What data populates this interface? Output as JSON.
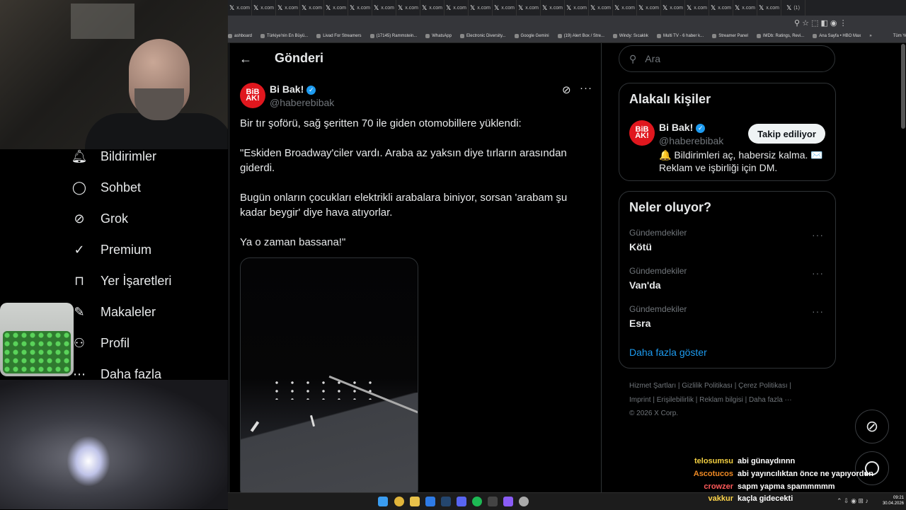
{
  "browser": {
    "tabs": [
      "x.com",
      "x.com",
      "x.com",
      "x.com",
      "x.com",
      "x.com",
      "x.com",
      "x.com",
      "x.com",
      "x.com",
      "x.com",
      "x.com",
      "x.com",
      "x.com",
      "x.com",
      "x.com",
      "x.com",
      "x.com",
      "x.com",
      "x.com",
      "x.com",
      "x.com",
      "x.com",
      "(1)"
    ],
    "bookmarks": [
      "ashboard",
      "Türkiye'nin En Büyü...",
      "Livad For Streamers",
      "(17145) Rammstein...",
      "WhatsApp",
      "Electronic Diversity...",
      "Google Gemini",
      "(19) Alert Box / Stre...",
      "Windy: Sıcaklık",
      "Multi TV - 6 haber k...",
      "Streamer Panel",
      "IMDb: Ratings, Revi...",
      "Ana Sayfa • HBO Max"
    ],
    "bookmarks_more": "»",
    "all_bookmarks": "Tüm Yer İşaretleri"
  },
  "sidebar": {
    "items": [
      {
        "label": "Bildirimler",
        "icon": "bell-icon"
      },
      {
        "label": "Sohbet",
        "icon": "chat-icon"
      },
      {
        "label": "Grok",
        "icon": "grok-icon"
      },
      {
        "label": "Premium",
        "icon": "premium-icon"
      },
      {
        "label": "Yer İşaretleri",
        "icon": "bookmark-icon"
      },
      {
        "label": "Makaleler",
        "icon": "article-icon"
      },
      {
        "label": "Profil",
        "icon": "profile-icon"
      },
      {
        "label": "Daha fazla",
        "icon": "more-icon"
      }
    ]
  },
  "post": {
    "header_title": "Gönderi",
    "author_name": "Bi Bak!",
    "author_handle": "@haberebibak",
    "avatar_text": "BiBAK!",
    "paragraphs": [
      "Bir tır şoförü, sağ şeritten 70 ile giden otomobillere yüklendi:",
      "\"Eskiden Broadway'ciler vardı. Araba az yaksın diye tırların arasından giderdi.",
      "Bugün onların çocukları elektrikli arabalara biniyor, sorsan 'arabam şu kadar beygir' diye hava atıyorlar.",
      "Ya o zaman bassana!\""
    ]
  },
  "right": {
    "search_placeholder": "Ara",
    "related_title": "Alakalı kişiler",
    "related_name": "Bi Bak!",
    "related_handle": "@haberebibak",
    "related_bio": "🔔 Bildirimleri aç, habersiz kalma. ✉️ Reklam ve işbirliği için DM.",
    "follow_label": "Takip ediliyor",
    "trends_title": "Neler oluyor?",
    "trends": [
      {
        "label": "Gündemdekiler",
        "name": "Kötü"
      },
      {
        "label": "Gündemdekiler",
        "name": "Van'da"
      },
      {
        "label": "Gündemdekiler",
        "name": "Esra"
      }
    ],
    "show_more": "Daha fazla göster",
    "footer_line1": [
      "Hizmet Şartları",
      "Gizlilik Politikası",
      "Çerez Politikası"
    ],
    "footer_line2": [
      "Imprint",
      "Erişilebilirlik",
      "Reklam bilgisi",
      "Daha fazla ···"
    ],
    "copyright": "© 2026 X Corp."
  },
  "chat": [
    {
      "user": "telosumsu",
      "color": "#f5d142",
      "message": "abi günaydınnn"
    },
    {
      "user": "Ascotucos",
      "color": "#f08a24",
      "message": "abi yayıncılıktan önce ne yapıyordun"
    },
    {
      "user": "crowzer",
      "color": "#ff5a5a",
      "message": "sapm yapma spammmmm"
    },
    {
      "user": "vakkur",
      "color": "#ffd54a",
      "message": "kaçla gidecekti"
    }
  ],
  "taskbar": {
    "time": "09:21",
    "date": "30.04.2026"
  },
  "colors": {
    "accent": "#1d9bf0",
    "brand_red": "#e0171e",
    "background": "#000000",
    "border": "#2f3336"
  }
}
